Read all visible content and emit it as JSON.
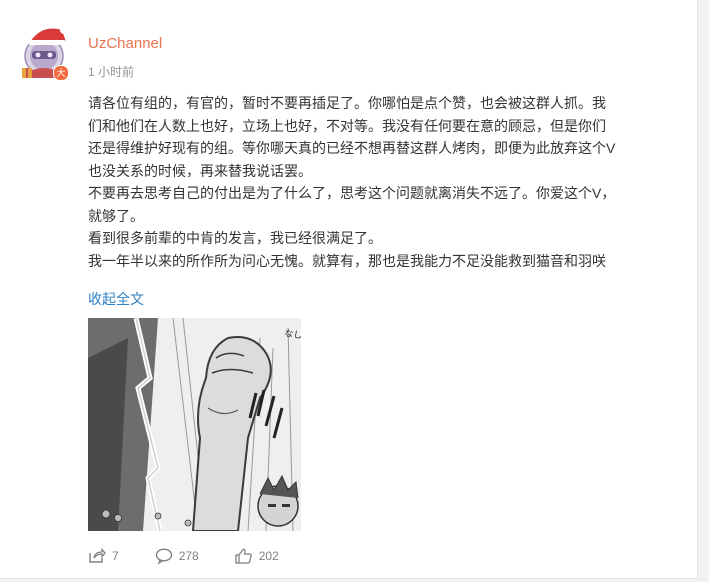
{
  "post": {
    "author": "UzChannel",
    "avatar_badge": "大",
    "timestamp": "1 小时前",
    "paragraphs": [
      "请各位有组的，有官的，暂时不要再插足了。你哪怕是点个赞，也会被这群人抓。我们和他们在人数上也好，立场上也好，不对等。我没有任何要在意的顾忌，但是你们还是得维护好现有的组。等你哪天真的已经不想再替这群人烤肉，即便为此放弃这个V也没关系的时候，再来替我说话罢。",
      "不要再去思考自己的付出是为了什么了，思考这个问题就离消失不远了。你爱这个V，就够了。",
      "看到很多前辈的中肯的发言，我已经很满足了。",
      "我一年半以来的所作所为问心无愧。就算有，那也是我能力不足没能救到猫音和羽咲"
    ],
    "collapse_label": "收起全文",
    "image_caption_text": "なし"
  },
  "actions": {
    "repost_count": "7",
    "comment_count": "278",
    "like_count": "202"
  },
  "colors": {
    "username": "#eb7350",
    "link": "#2c7fc4",
    "body_text": "#333333",
    "muted": "#939393"
  }
}
